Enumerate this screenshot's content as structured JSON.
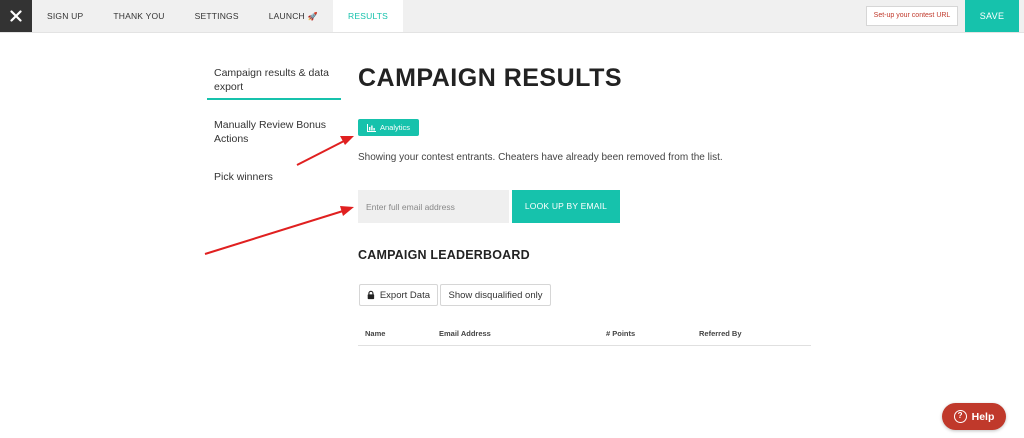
{
  "topbar": {
    "tabs": [
      {
        "label": "SIGN UP",
        "active": false
      },
      {
        "label": "THANK YOU",
        "active": false
      },
      {
        "label": "SETTINGS",
        "active": false
      },
      {
        "label": "LAUNCH",
        "active": false,
        "icon": "rocket-icon"
      },
      {
        "label": "RESULTS",
        "active": true
      }
    ],
    "setup_url_label": "Set-up your contest URL",
    "save_label": "SAVE"
  },
  "sidebar": {
    "items": [
      {
        "label": "Campaign results & data export",
        "active": true
      },
      {
        "label": "Manually Review Bonus Actions",
        "active": false
      },
      {
        "label": "Pick winners",
        "active": false
      }
    ]
  },
  "main": {
    "title": "CAMPAIGN RESULTS",
    "analytics_label": "Analytics",
    "description": "Showing your contest entrants. Cheaters have already been removed from the list.",
    "email_placeholder": "Enter full email address",
    "email_value": "",
    "lookup_label": "LOOK UP BY EMAIL",
    "leaderboard_title": "CAMPAIGN LEADERBOARD",
    "export_label": "Export Data",
    "disqualified_label": "Show disqualified only",
    "table_columns": [
      "Name",
      "Email Address",
      "# Points",
      "Referred By"
    ]
  },
  "help": {
    "label": "Help"
  },
  "colors": {
    "accent": "#16c2ac",
    "dark": "#333333",
    "help": "#c0392b",
    "arrow": "#e02020"
  }
}
